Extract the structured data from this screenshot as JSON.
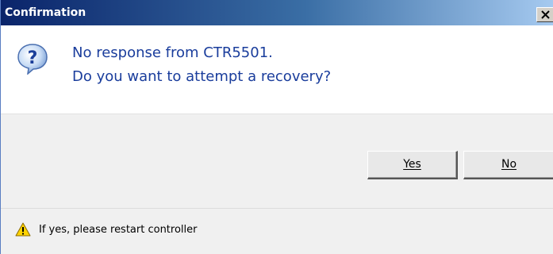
{
  "window": {
    "title": "Confirmation"
  },
  "icons": {
    "title_close": "close-icon",
    "message": "question-icon",
    "footer": "warning-icon"
  },
  "message": {
    "line1": "No response from CTR5501.",
    "line2": "Do you want to attempt a recovery?"
  },
  "buttons": {
    "yes_label": "Yes",
    "no_label": "No"
  },
  "footer": {
    "text": "If yes, please restart controller"
  },
  "colors": {
    "message_text": "#1a3d9c",
    "title_bar_start": "#0a246a",
    "warning_fill": "#ffd400"
  }
}
